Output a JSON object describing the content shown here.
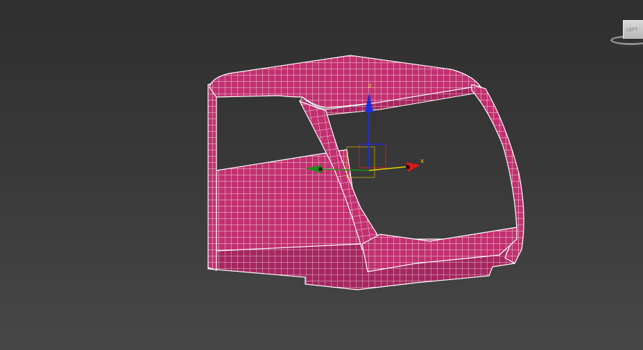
{
  "viewport": {
    "background_top": "#2f2f2f",
    "background_bottom": "#474747"
  },
  "model": {
    "name": "excavator-cab-wireframe",
    "fill_color": "#c2306f",
    "wire_color": "#f4dbe7"
  },
  "gizmo": {
    "x_label": "x",
    "z_label": "z",
    "x_color": "#d81b1b",
    "y_color": "#1e8f1e",
    "z_color": "#1c2fe0",
    "label_color": "#e8d400"
  },
  "viewcube": {
    "face_label": "LEFT",
    "color": "#c8c8c8"
  }
}
